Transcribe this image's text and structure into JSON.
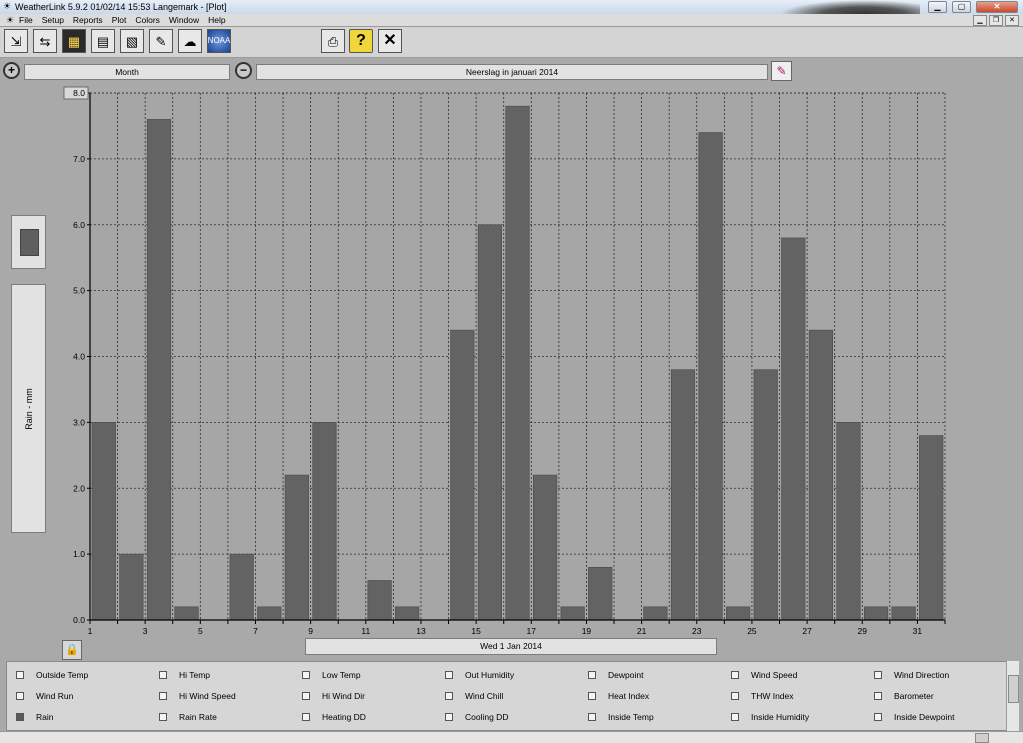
{
  "window": {
    "title": "WeatherLink 5.9.2  01/02/14  15:53  Langemark - [Plot]"
  },
  "menu": {
    "items": [
      "File",
      "Setup",
      "Reports",
      "Plot",
      "Colors",
      "Window",
      "Help"
    ]
  },
  "toolbar": {
    "buttons": [
      {
        "name": "import-data-icon",
        "glyph": "⇲"
      },
      {
        "name": "connect-icon",
        "glyph": "⇆"
      },
      {
        "name": "bulletin-icon",
        "glyph": "▦"
      },
      {
        "name": "plot-icon",
        "glyph": "▤"
      },
      {
        "name": "strip-chart-icon",
        "glyph": "▧"
      },
      {
        "name": "notes-icon",
        "glyph": "✎"
      },
      {
        "name": "noaa-report-icon",
        "glyph": "☁"
      },
      {
        "name": "noaa-logo-icon",
        "glyph": "NOAA"
      },
      {
        "name": "print-icon",
        "glyph": "⎙"
      },
      {
        "name": "help-icon",
        "glyph": "?"
      },
      {
        "name": "close-plot-icon",
        "glyph": "✕"
      }
    ]
  },
  "zoom": {
    "period": "Month",
    "plot_title": "Neerslag in januari 2014"
  },
  "side": {
    "label": "Rain - mm"
  },
  "footer": {
    "date_label": "Wed 1 Jan 2014"
  },
  "chart_data": {
    "type": "bar",
    "title": "Neerslag in januari 2014",
    "xlabel": "Wed 1 Jan 2014",
    "ylabel": "Rain - mm",
    "ylim": [
      0,
      8
    ],
    "yticks": [
      "0.0",
      "1.0",
      "2.0",
      "3.0",
      "4.0",
      "5.0",
      "6.0",
      "7.0",
      "8.0"
    ],
    "grid": true,
    "bar_color": "#636363",
    "x_tick_labels": [
      "1",
      "3",
      "5",
      "7",
      "9",
      "11",
      "13",
      "15",
      "17",
      "19",
      "21",
      "23",
      "25",
      "27",
      "29",
      "31"
    ],
    "categories": [
      1,
      2,
      3,
      4,
      5,
      6,
      7,
      8,
      9,
      10,
      11,
      12,
      13,
      14,
      15,
      16,
      17,
      18,
      19,
      20,
      21,
      22,
      23,
      24,
      25,
      26,
      27,
      28,
      29,
      30,
      31
    ],
    "values": [
      3.0,
      1.0,
      7.6,
      0.2,
      0.0,
      1.0,
      0.2,
      2.2,
      3.0,
      0.0,
      0.6,
      0.2,
      0.0,
      4.4,
      6.0,
      7.8,
      2.2,
      0.2,
      0.8,
      0.0,
      0.2,
      3.8,
      7.4,
      0.2,
      3.8,
      5.8,
      4.4,
      3.0,
      0.2,
      0.2,
      2.8
    ]
  },
  "checkboxes": [
    {
      "label": "Outside Temp",
      "checked": false
    },
    {
      "label": "Hi Temp",
      "checked": false
    },
    {
      "label": "Low Temp",
      "checked": false
    },
    {
      "label": "Out Humidity",
      "checked": false
    },
    {
      "label": "Dewpoint",
      "checked": false
    },
    {
      "label": "Wind Speed",
      "checked": false
    },
    {
      "label": "Wind Direction",
      "checked": false
    },
    {
      "label": "Wind Run",
      "checked": false
    },
    {
      "label": "Hi Wind Speed",
      "checked": false
    },
    {
      "label": "Hi Wind Dir",
      "checked": false
    },
    {
      "label": "Wind Chill",
      "checked": false
    },
    {
      "label": "Heat Index",
      "checked": false
    },
    {
      "label": "THW Index",
      "checked": false
    },
    {
      "label": "Barometer",
      "checked": false
    },
    {
      "label": "Rain",
      "checked": true
    },
    {
      "label": "Rain Rate",
      "checked": false
    },
    {
      "label": "Heating DD",
      "checked": false
    },
    {
      "label": "Cooling DD",
      "checked": false
    },
    {
      "label": "Inside Temp",
      "checked": false
    },
    {
      "label": "Inside Humidity",
      "checked": false
    },
    {
      "label": "Inside Dewpoint",
      "checked": false
    }
  ]
}
